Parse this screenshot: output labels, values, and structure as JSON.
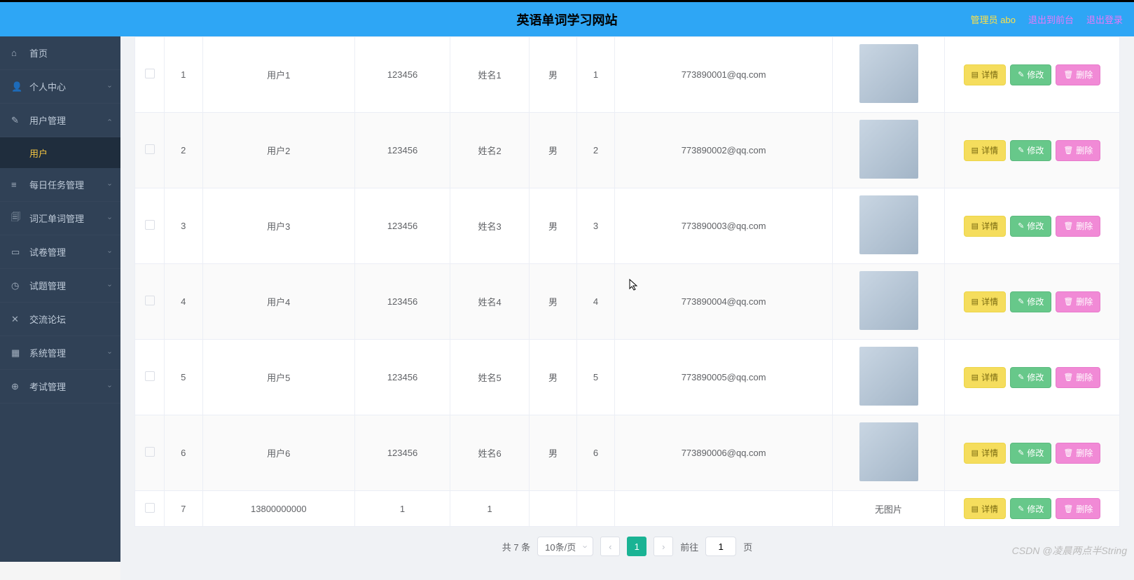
{
  "header": {
    "title": "英语单词学习网站",
    "admin_label": "管理员 abo",
    "logout_front": "退出到前台",
    "logout": "退出登录"
  },
  "sidebar": {
    "items": [
      {
        "icon": "⌂",
        "label": "首页",
        "has_children": false
      },
      {
        "icon": "👤",
        "label": "个人中心",
        "has_children": true
      },
      {
        "icon": "✎",
        "label": "用户管理",
        "has_children": true,
        "open": true,
        "children": [
          {
            "label": "用户",
            "active": true
          }
        ]
      },
      {
        "icon": "≡",
        "label": "每日任务管理",
        "has_children": true
      },
      {
        "icon": "🗐",
        "label": "词汇单词管理",
        "has_children": true
      },
      {
        "icon": "▭",
        "label": "试卷管理",
        "has_children": true
      },
      {
        "icon": "◷",
        "label": "试题管理",
        "has_children": true
      },
      {
        "icon": "✕",
        "label": "交流论坛",
        "has_children": false
      },
      {
        "icon": "▦",
        "label": "系统管理",
        "has_children": true
      },
      {
        "icon": "⊕",
        "label": "考试管理",
        "has_children": true
      }
    ]
  },
  "table": {
    "rows": [
      {
        "id": "1",
        "username": "用户1",
        "password": "123456",
        "name": "姓名1",
        "gender": "男",
        "num": "1",
        "email": "773890001@qq.com",
        "has_img": true
      },
      {
        "id": "2",
        "username": "用户2",
        "password": "123456",
        "name": "姓名2",
        "gender": "男",
        "num": "2",
        "email": "773890002@qq.com",
        "has_img": true
      },
      {
        "id": "3",
        "username": "用户3",
        "password": "123456",
        "name": "姓名3",
        "gender": "男",
        "num": "3",
        "email": "773890003@qq.com",
        "has_img": true
      },
      {
        "id": "4",
        "username": "用户4",
        "password": "123456",
        "name": "姓名4",
        "gender": "男",
        "num": "4",
        "email": "773890004@qq.com",
        "has_img": true
      },
      {
        "id": "5",
        "username": "用户5",
        "password": "123456",
        "name": "姓名5",
        "gender": "男",
        "num": "5",
        "email": "773890005@qq.com",
        "has_img": true
      },
      {
        "id": "6",
        "username": "用户6",
        "password": "123456",
        "name": "姓名6",
        "gender": "男",
        "num": "6",
        "email": "773890006@qq.com",
        "has_img": true
      },
      {
        "id": "7",
        "username": "13800000000",
        "password": "1",
        "name": "1",
        "gender": "",
        "num": "",
        "email": "",
        "has_img": false
      }
    ],
    "no_image_text": "无图片",
    "actions": {
      "detail": "详情",
      "edit": "修改",
      "delete": "删除"
    }
  },
  "pagination": {
    "total_text": "共 7 条",
    "page_size_text": "10条/页",
    "current_page": "1",
    "goto_prefix": "前往",
    "goto_suffix": "页",
    "goto_value": "1"
  },
  "watermark": "CSDN @凌晨两点半String"
}
